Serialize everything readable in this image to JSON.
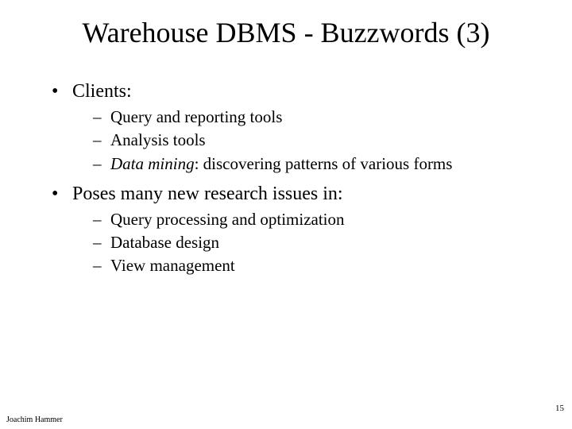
{
  "slide": {
    "title": "Warehouse DBMS - Buzzwords (3)",
    "bullets": [
      {
        "text": "Clients:",
        "sub": [
          {
            "text": "Query and reporting tools"
          },
          {
            "text": "Analysis tools"
          },
          {
            "italicLead": "Data mining",
            "rest": ": discovering patterns of various forms"
          }
        ]
      },
      {
        "text": "Poses many new research issues in:",
        "sub": [
          {
            "text": "Query processing and optimization"
          },
          {
            "text": "Database design"
          },
          {
            "text": "View management"
          }
        ]
      }
    ],
    "footer": {
      "author": "Joachim Hammer",
      "page": "15"
    }
  }
}
